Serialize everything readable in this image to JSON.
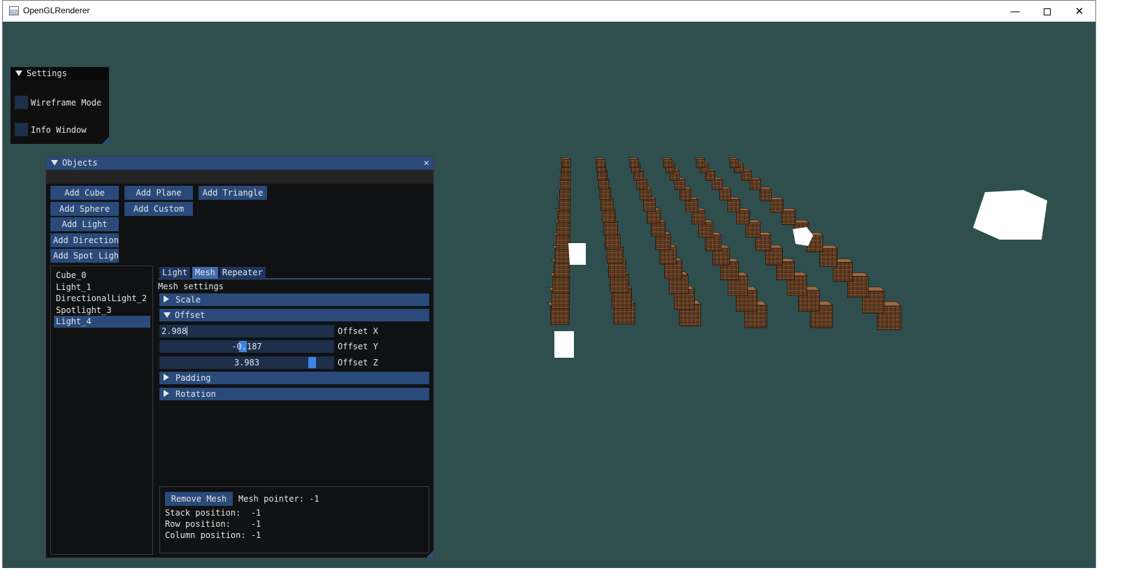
{
  "window": {
    "title": "OpenGLRenderer",
    "minimize": "—",
    "close": "✕"
  },
  "settings": {
    "title": "Settings",
    "checkboxes": [
      {
        "label": "Wireframe Mode",
        "checked": false
      },
      {
        "label": "Info Window",
        "checked": false
      }
    ]
  },
  "objects": {
    "title": "Objects",
    "close": "✕",
    "buttons": {
      "add_cube": "Add Cube",
      "add_plane": "Add Plane",
      "add_triangle": "Add Triangle",
      "add_sphere": "Add Sphere",
      "add_custom": "Add Custom",
      "add_light": "Add Light",
      "add_directional": "Add Directional",
      "add_spot_light": "Add Spot Light"
    },
    "list": [
      "Cube_0",
      "Light_1",
      "DirectionalLight_2",
      "Spotlight_3",
      "Light_4"
    ],
    "selected_index": 4,
    "tabs": [
      "Light",
      "Mesh",
      "Repeater"
    ],
    "active_tab": "Mesh",
    "mesh_settings_label": "Mesh settings",
    "headers": {
      "scale": "Scale",
      "offset": "Offset",
      "padding": "Padding",
      "rotation": "Rotation"
    },
    "offset": {
      "x": {
        "value": "2.988",
        "label": "Offset X"
      },
      "y": {
        "value": "-0.187",
        "label": "Offset Y"
      },
      "z": {
        "value": "3.983",
        "label": "Offset Z"
      }
    },
    "remove_mesh": "Remove Mesh",
    "mesh_pointer": "Mesh pointer: -1",
    "stack_position": "Stack position:  -1",
    "row_position": "Row position:    -1",
    "column_position": "Column position: -1"
  },
  "colors": {
    "background": "#2f4f4f",
    "imgui_accent": "#294a7a",
    "slider_grab": "#3d85e0"
  },
  "icons": [
    "window-app-icon",
    "minimize-icon",
    "maximize-icon",
    "close-icon",
    "collapse-triangle-icon",
    "expand-triangle-icon"
  ]
}
